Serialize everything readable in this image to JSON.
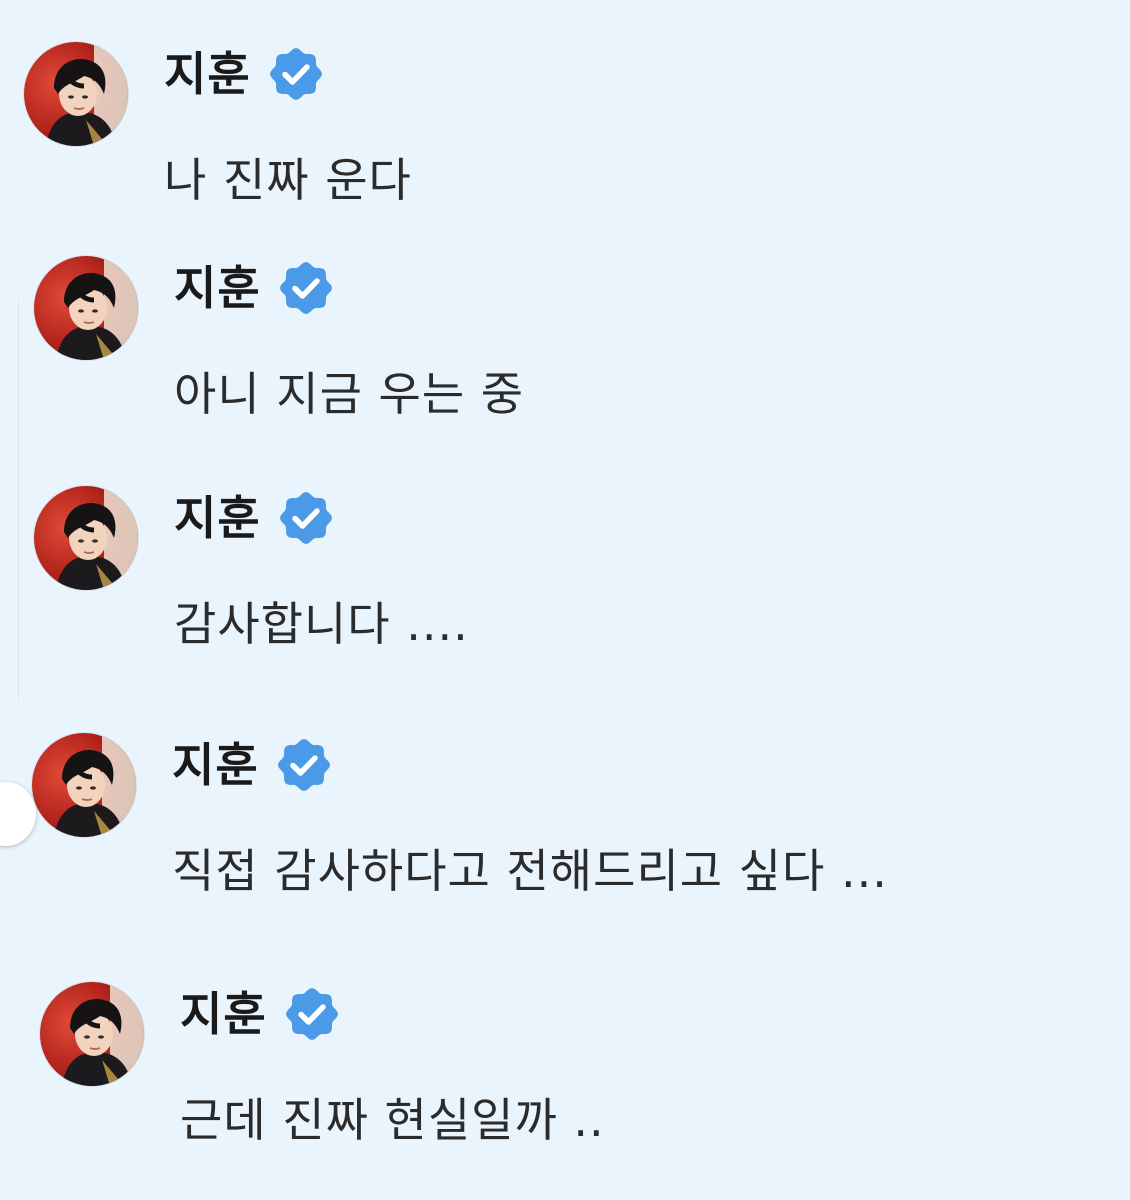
{
  "theme": {
    "background": "#eaf4fc",
    "verified_color": "#4a9ae8",
    "name_color": "#1a1a1a",
    "text_color": "#2b2b2b"
  },
  "messages": [
    {
      "sender": "지훈",
      "verified": true,
      "avatar_icon": "profile-photo",
      "text": "나 진짜 운다"
    },
    {
      "sender": "지훈",
      "verified": true,
      "avatar_icon": "profile-photo",
      "text": "아니 지금 우는 중"
    },
    {
      "sender": "지훈",
      "verified": true,
      "avatar_icon": "profile-photo",
      "text": "감사합니다 ...."
    },
    {
      "sender": "지훈",
      "verified": true,
      "avatar_icon": "profile-photo",
      "text": "직접 감사하다고 전해드리고 싶다 ..."
    },
    {
      "sender": "지훈",
      "verified": true,
      "avatar_icon": "profile-photo",
      "text": "근데 진짜 현실일까 .."
    }
  ]
}
